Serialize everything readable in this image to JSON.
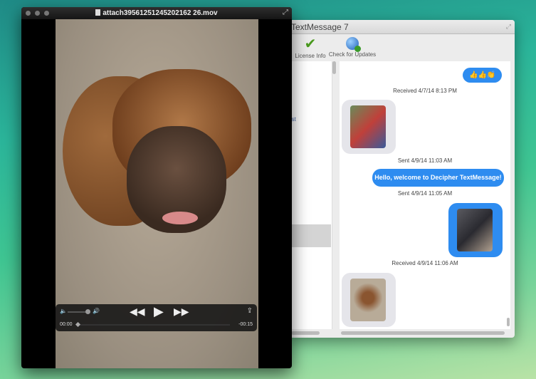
{
  "message_window": {
    "title": "TextMessage 7",
    "toolbar": [
      {
        "label": "License Info",
        "icon": "checkmark-icon"
      },
      {
        "label": "Check for Updates",
        "icon": "globe-download-icon"
      }
    ],
    "list_fragment": "est",
    "messages": [
      {
        "type": "sent",
        "text": "👍👍👏"
      },
      {
        "type": "timestamp",
        "text": "Received 4/7/14 8:13 PM"
      },
      {
        "type": "received-image"
      },
      {
        "type": "timestamp",
        "text": "Sent 4/9/14 11:03 AM"
      },
      {
        "type": "sent",
        "text": "Hello, welcome to Decipher TextMessage!"
      },
      {
        "type": "timestamp",
        "text": "Sent 4/9/14 11:05 AM"
      },
      {
        "type": "sent-image"
      },
      {
        "type": "timestamp",
        "text": "Received 4/9/14 11:06 AM"
      },
      {
        "type": "received-image"
      }
    ]
  },
  "video_window": {
    "title": "attach39561251245202162 26.mov",
    "controls": {
      "current_time": "00:00",
      "remaining_time": "-00:15",
      "progress": 0.0,
      "volume": 0.8
    }
  },
  "colors": {
    "bubble_blue": "#2e8cf0",
    "bubble_gray": "#e5e5ea"
  }
}
